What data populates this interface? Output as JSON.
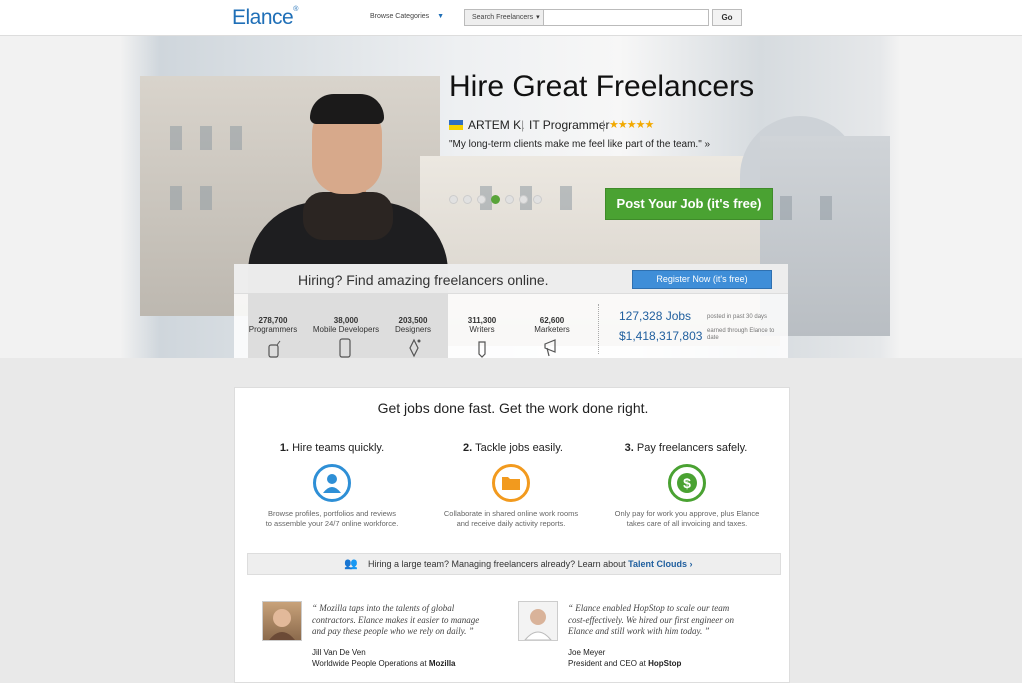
{
  "header": {
    "logo": "Elance",
    "logo_mark": "®",
    "browse_label": "Browse Categories",
    "search_dropdown": "Search Freelancers",
    "search_placeholder": "",
    "go_label": "Go"
  },
  "hero": {
    "title": "Hire Great Freelancers",
    "freelancer_name": "ARTEM K.",
    "freelancer_role": "IT Programmer",
    "rating_stars": "★★★★★",
    "rating": 5,
    "quote": "\"My long-term clients make me feel like part of the team.\" »",
    "slides_total": 7,
    "slide_active": 4,
    "cta": "Post Your Job (it's free)"
  },
  "hiring_panel": {
    "heading": "Hiring? Find amazing freelancers online.",
    "register_label": "Register Now (it's free)",
    "categories": [
      {
        "count": "278,700",
        "label": "Programmers",
        "icon": "programmer-icon"
      },
      {
        "count": "38,000",
        "label": "Mobile Developers",
        "icon": "mobile-icon"
      },
      {
        "count": "203,500",
        "label": "Designers",
        "icon": "pen-icon"
      },
      {
        "count": "311,300",
        "label": "Writers",
        "icon": "pencil-icon"
      },
      {
        "count": "62,600",
        "label": "Marketers",
        "icon": "megaphone-icon"
      }
    ],
    "stats": [
      {
        "value": "127,328 Jobs",
        "note": "posted in past 30 days"
      },
      {
        "value": "$1,418,317,803",
        "note": "earned through Elance to date"
      }
    ]
  },
  "content": {
    "title": "Get jobs done fast. Get the work done right.",
    "steps": [
      {
        "num": "1.",
        "title": "Hire teams quickly.",
        "desc1": "Browse profiles, portfolios and reviews",
        "desc2": "to assemble your 24/7 online workforce.",
        "icon": "user-icon",
        "color": "#2e8fd6"
      },
      {
        "num": "2.",
        "title": "Tackle jobs easily.",
        "desc1": "Collaborate in shared online work rooms",
        "desc2": "and receive daily activity reports.",
        "icon": "folder-icon",
        "color": "#f29a1e"
      },
      {
        "num": "3.",
        "title": "Pay freelancers safely.",
        "desc1": "Only pay for work you approve, plus Elance",
        "desc2": "takes care of all invoicing and taxes.",
        "icon": "dollar-icon",
        "color": "#4aa232"
      }
    ],
    "talent_text": "Hiring a large team? Managing freelancers already? Learn about",
    "talent_link": "Talent Clouds ›",
    "testimonials": [
      {
        "line1": "“ Mozilla taps into the talents of global",
        "line2": "contractors. Elance makes it easier to manage",
        "line3": "and pay these people who we rely on daily. ”",
        "name": "Jill Van De Ven",
        "title_prefix": "Worldwide People Operations at",
        "company": "Mozilla"
      },
      {
        "line1": "“ Elance enabled HopStop to scale our team",
        "line2": "cost-effectively. We hired our first engineer on",
        "line3": "Elance and still work with him today. ”",
        "name": "Joe Meyer",
        "title_prefix": "President and CEO at",
        "company": "HopStop"
      }
    ]
  }
}
